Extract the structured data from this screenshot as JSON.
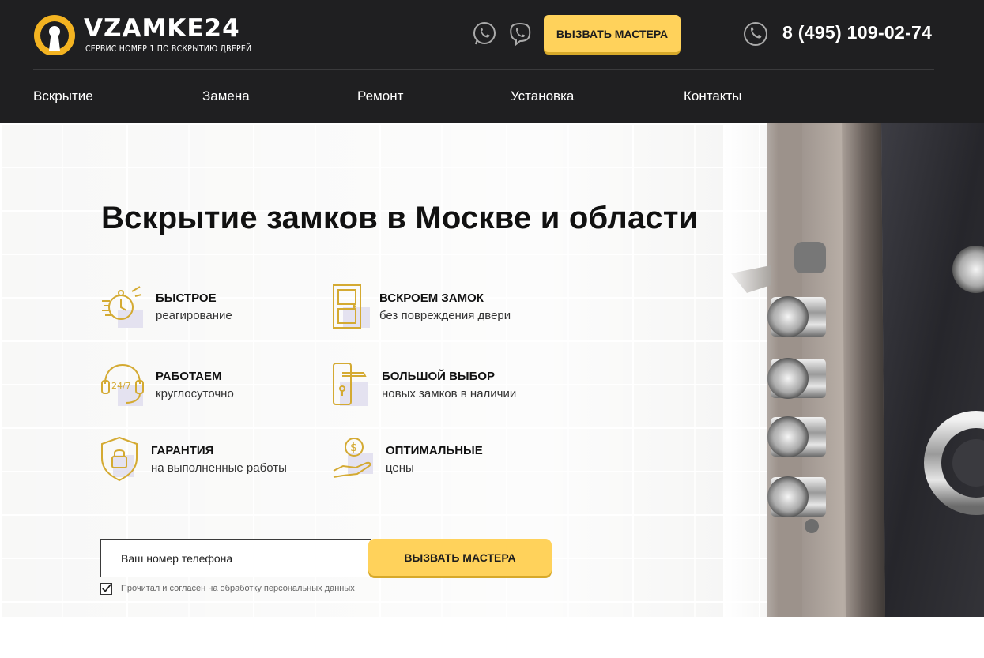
{
  "header": {
    "logo_word": "VZAMKE",
    "logo_number": "24",
    "logo_tagline": "СЕРВИС НОМЕР 1 ПО ВСКРЫТИЮ ДВЕРЕЙ",
    "call_button": "ВЫЗВАТЬ МАСТЕРА",
    "phone": "8 (495) 109-02-74",
    "icons": [
      "whatsapp-icon",
      "viber-icon",
      "phone-icon"
    ]
  },
  "nav": {
    "items": [
      {
        "label": "Вскрытие"
      },
      {
        "label": "Замена"
      },
      {
        "label": "Ремонт"
      },
      {
        "label": "Установка"
      },
      {
        "label": "Контакты"
      }
    ]
  },
  "hero": {
    "title": "Вскрытие замков в Москве и области",
    "features": [
      {
        "title": "БЫСТРОЕ",
        "subtitle": "реагирование",
        "icon": "clock-icon"
      },
      {
        "title": "ВСКРОЕМ ЗАМОК",
        "subtitle": "без повреждения двери",
        "icon": "door-icon"
      },
      {
        "title": "РАБОТАЕМ",
        "subtitle": "круглосуточно",
        "icon": "headset-24-7-icon"
      },
      {
        "title": "БОЛЬШОЙ ВЫБОР",
        "subtitle": "новых замков в наличии",
        "icon": "door-handle-icon"
      },
      {
        "title": "ГАРАНТИЯ",
        "subtitle": "на выполненные работы",
        "icon": "shield-lock-icon"
      },
      {
        "title": "ОПТИМАЛЬНЫЕ",
        "subtitle": "цены",
        "icon": "coin-hand-icon"
      }
    ],
    "form": {
      "phone_placeholder": "Ваш номер телефона",
      "phone_value": "",
      "submit_label": "ВЫЗВАТЬ МАСТЕРА",
      "consent_checked": true,
      "consent_text": "Прочитал и согласен на обработку персональных данных"
    }
  },
  "colors": {
    "header_bg": "#1f1f21",
    "accent": "#ffd25b",
    "icon_gold": "#d4aa32"
  }
}
